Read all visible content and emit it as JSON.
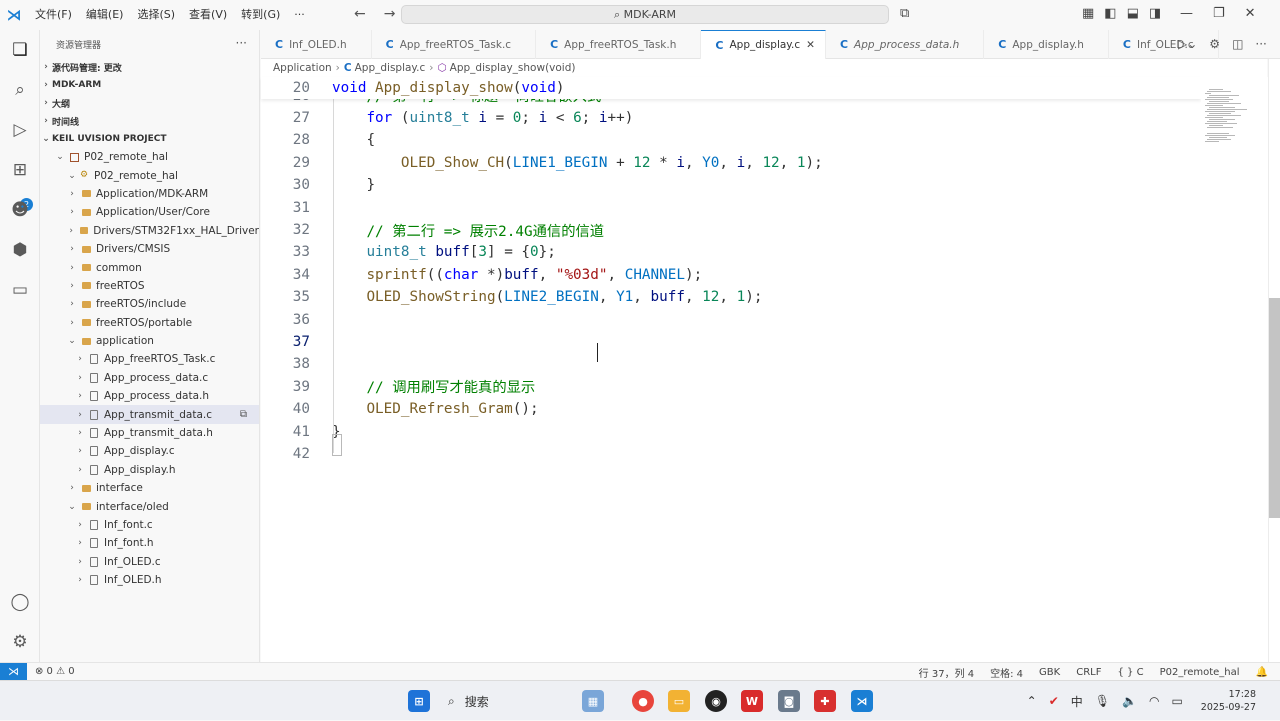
{
  "window": {
    "menus": [
      "文件(F)",
      "编辑(E)",
      "选择(S)",
      "查看(V)",
      "转到(G)",
      "···"
    ],
    "search_text": "MDK-ARM"
  },
  "sidebar": {
    "title": "资源管理器",
    "sections": {
      "scm": "源代码管理: 更改",
      "mdk": "MDK-ARM",
      "outline": "大纲",
      "timeline": "时间线",
      "keil": "KEIL UVISION PROJECT"
    },
    "tree": [
      {
        "label": "P02_remote_hal",
        "level": 1,
        "kind": "proj",
        "open": true
      },
      {
        "label": "P02_remote_hal",
        "level": 2,
        "kind": "target",
        "open": true
      },
      {
        "label": "Application/MDK-ARM",
        "level": 3,
        "kind": "folder"
      },
      {
        "label": "Application/User/Core",
        "level": 3,
        "kind": "folder"
      },
      {
        "label": "Drivers/STM32F1xx_HAL_Driver",
        "level": 3,
        "kind": "folder"
      },
      {
        "label": "Drivers/CMSIS",
        "level": 3,
        "kind": "folder"
      },
      {
        "label": "common",
        "level": 3,
        "kind": "folder"
      },
      {
        "label": "freeRTOS",
        "level": 3,
        "kind": "folder"
      },
      {
        "label": "freeRTOS/include",
        "level": 3,
        "kind": "folder"
      },
      {
        "label": "freeRTOS/portable",
        "level": 3,
        "kind": "folder"
      },
      {
        "label": "application",
        "level": 3,
        "kind": "folder",
        "open": true
      },
      {
        "label": "App_freeRTOS_Task.c",
        "level": 4,
        "kind": "file"
      },
      {
        "label": "App_process_data.c",
        "level": 4,
        "kind": "file"
      },
      {
        "label": "App_process_data.h",
        "level": 4,
        "kind": "file"
      },
      {
        "label": "App_transmit_data.c",
        "level": 4,
        "kind": "file",
        "selected": true
      },
      {
        "label": "App_transmit_data.h",
        "level": 4,
        "kind": "file"
      },
      {
        "label": "App_display.c",
        "level": 4,
        "kind": "file"
      },
      {
        "label": "App_display.h",
        "level": 4,
        "kind": "file"
      },
      {
        "label": "interface",
        "level": 3,
        "kind": "folder"
      },
      {
        "label": "interface/oled",
        "level": 3,
        "kind": "folder",
        "open": true
      },
      {
        "label": "Inf_font.c",
        "level": 4,
        "kind": "file"
      },
      {
        "label": "Inf_font.h",
        "level": 4,
        "kind": "file"
      },
      {
        "label": "Inf_OLED.c",
        "level": 4,
        "kind": "file"
      },
      {
        "label": "Inf_OLED.h",
        "level": 4,
        "kind": "file"
      }
    ]
  },
  "tabs": [
    {
      "label": "Inf_OLED.h",
      "active": false,
      "italic": false
    },
    {
      "label": "App_freeRTOS_Task.c",
      "active": false,
      "italic": false
    },
    {
      "label": "App_freeRTOS_Task.h",
      "active": false,
      "italic": false
    },
    {
      "label": "App_display.c",
      "active": true,
      "italic": false
    },
    {
      "label": "App_process_data.h",
      "active": false,
      "italic": true
    },
    {
      "label": "App_display.h",
      "active": false,
      "italic": false
    },
    {
      "label": "Inf_OLED.c",
      "active": false,
      "italic": false
    }
  ],
  "breadcrumb": [
    "Application",
    "App_display.c",
    "App_display_show(void)"
  ],
  "editor": {
    "sticky_line": {
      "num": "20",
      "text": "void App_display_show(void)"
    },
    "current_line": "37",
    "lines": [
      {
        "num": "26",
        "text": "    // 第一行 => 标题  尚硅谷嵌入式"
      },
      {
        "num": "27",
        "text": "    for (uint8_t i = 0; i < 6; i++)"
      },
      {
        "num": "28",
        "text": "    {"
      },
      {
        "num": "29",
        "text": "        OLED_Show_CH(LINE1_BEGIN + 12 * i, Y0, i, 12, 1);"
      },
      {
        "num": "30",
        "text": "    }"
      },
      {
        "num": "31",
        "text": ""
      },
      {
        "num": "32",
        "text": "    // 第二行 => 展示2.4G通信的信道"
      },
      {
        "num": "33",
        "text": "    uint8_t buff[3] = {0};"
      },
      {
        "num": "34",
        "text": "    sprintf((char *)buff, \"%03d\", CHANNEL);"
      },
      {
        "num": "35",
        "text": "    OLED_ShowString(LINE2_BEGIN, Y1, buff, 12, 1);"
      },
      {
        "num": "36",
        "text": ""
      },
      {
        "num": "37",
        "text": ""
      },
      {
        "num": "38",
        "text": ""
      },
      {
        "num": "39",
        "text": "    // 调用刷写才能真的显示"
      },
      {
        "num": "40",
        "text": "    OLED_Refresh_Gram();"
      },
      {
        "num": "41",
        "text": "}"
      },
      {
        "num": "42",
        "text": ""
      }
    ]
  },
  "statusbar": {
    "problems": "⊗ 0 ⚠ 0",
    "position": "行 37，列 4",
    "spaces": "空格: 4",
    "encoding": "GBK",
    "eol": "CRLF",
    "lang": "{ } C",
    "project": "P02_remote_hal"
  },
  "taskbar": {
    "search_label": "搜索",
    "time": "17:28",
    "date": "2025-09-27"
  }
}
